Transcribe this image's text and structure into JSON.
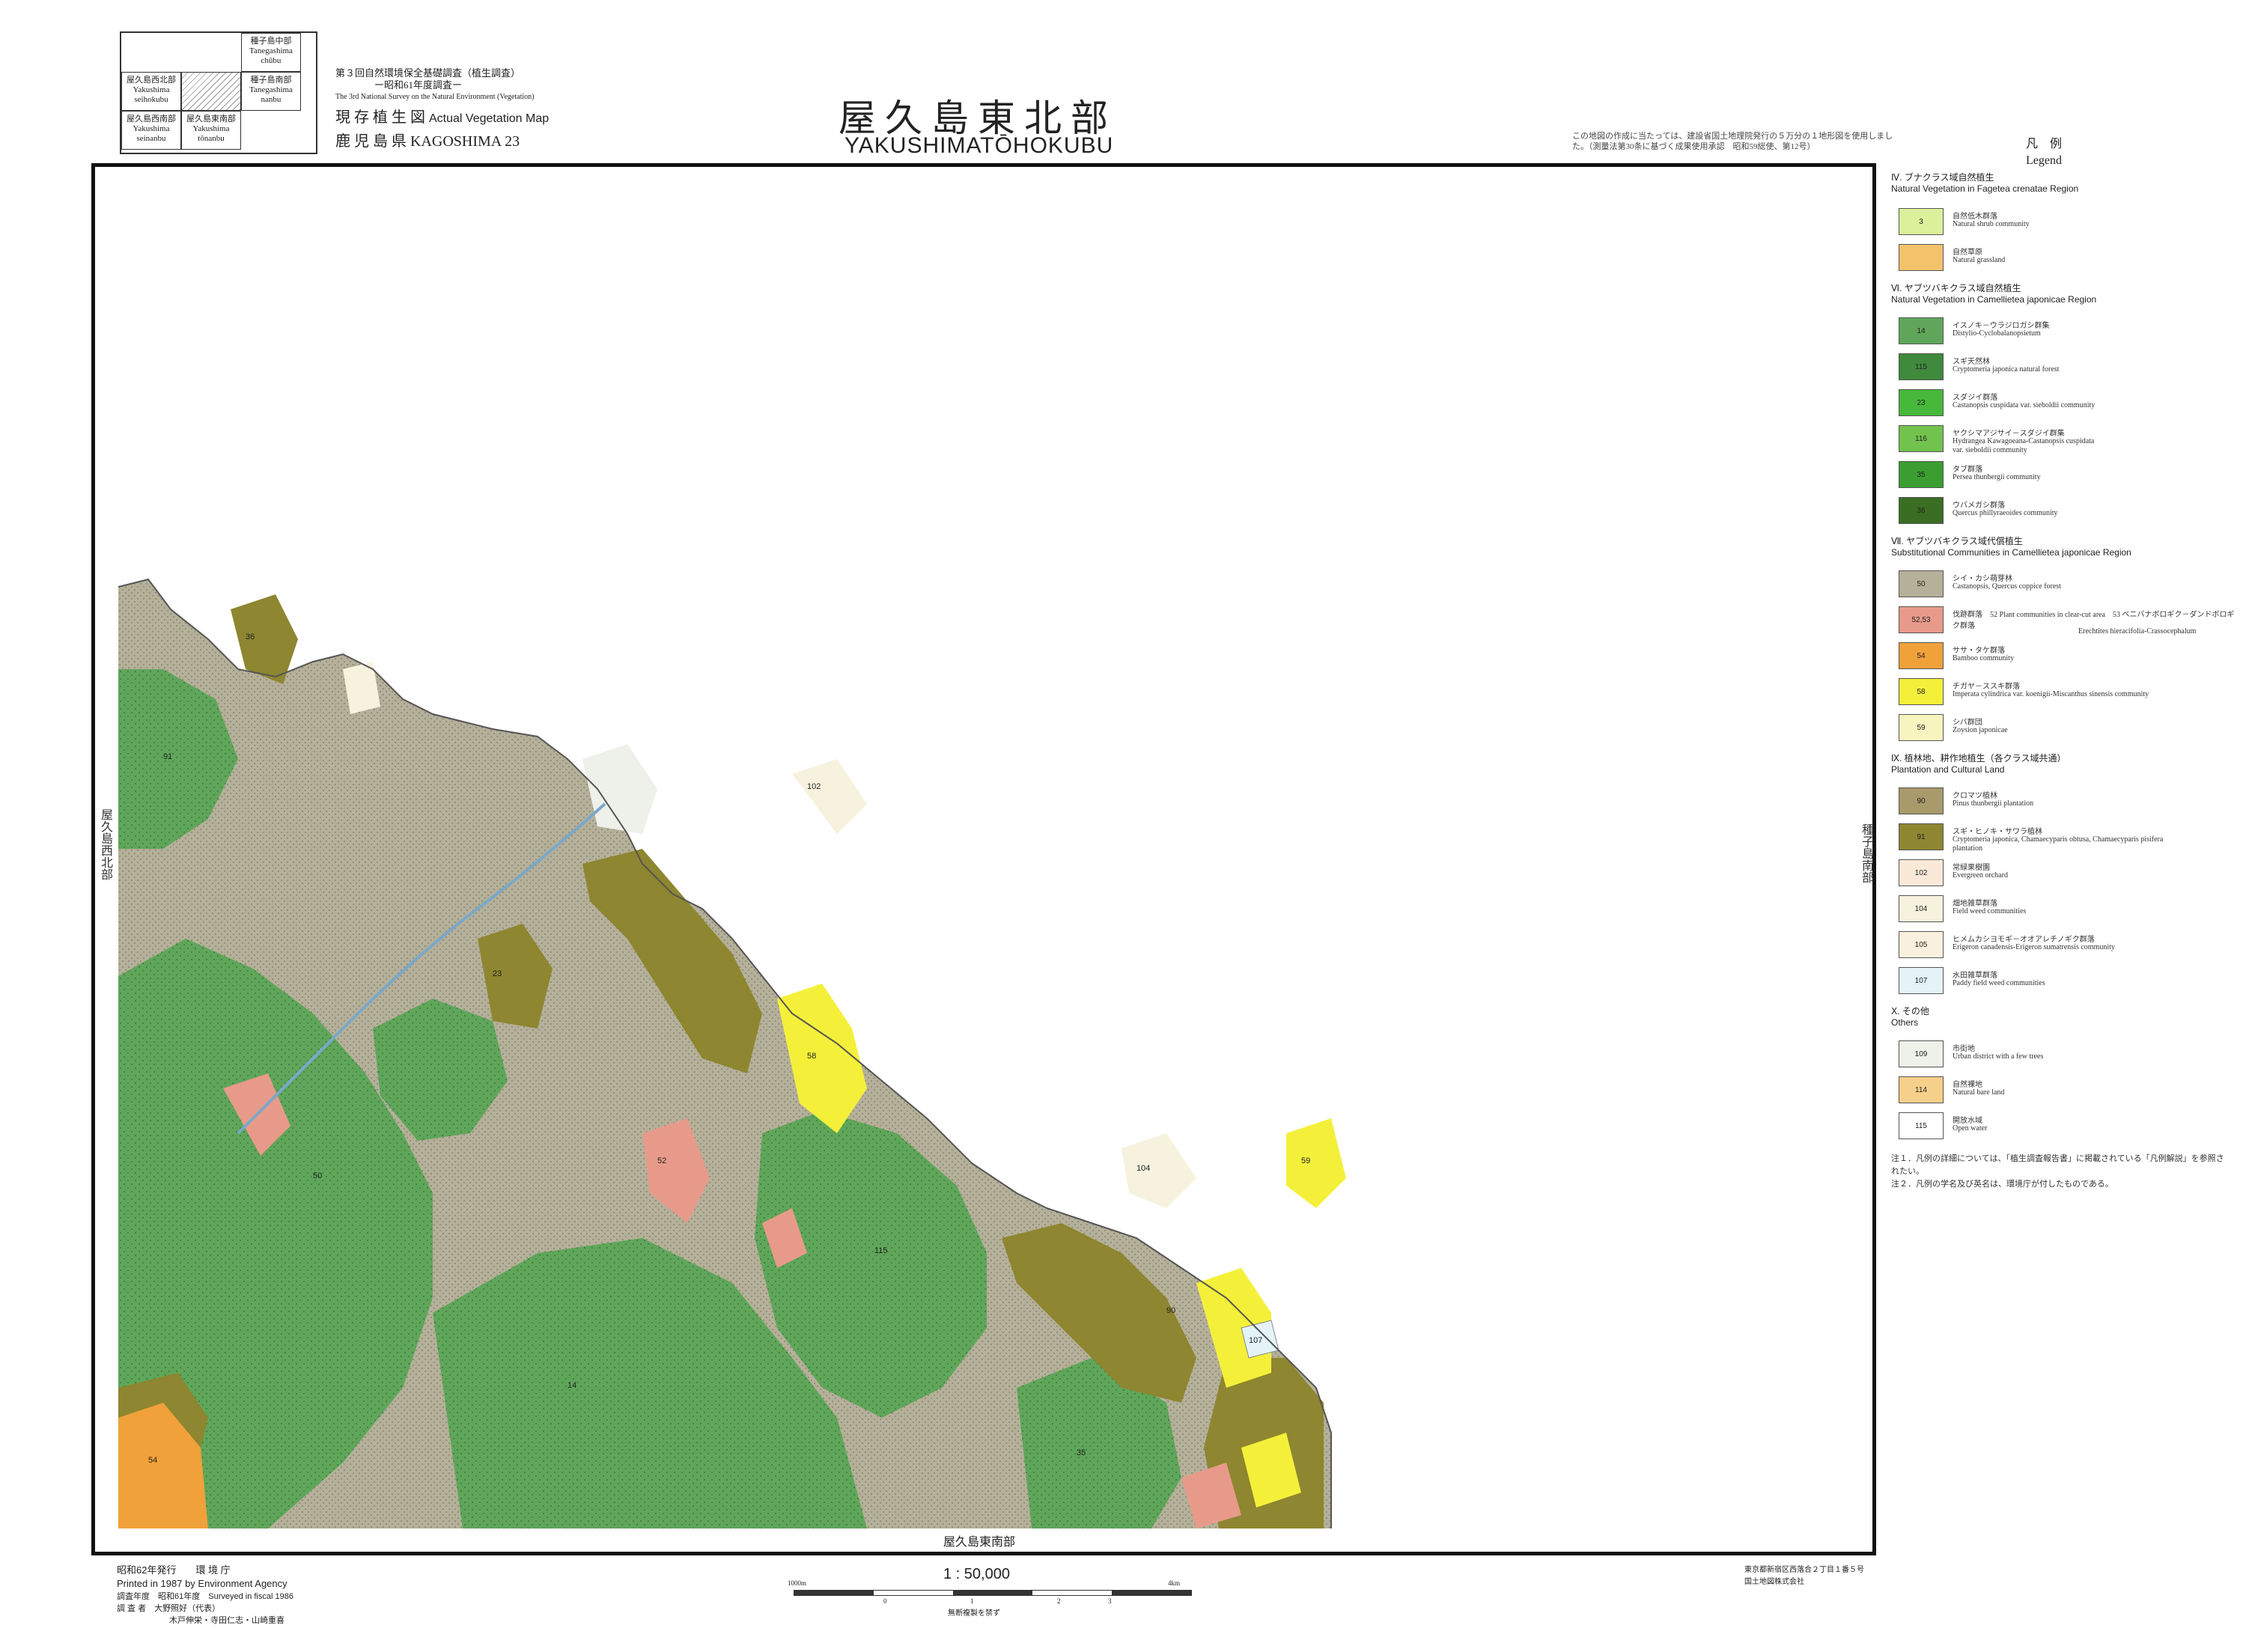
{
  "index_map": {
    "cells": [
      {
        "jp": "種子島中部",
        "en": "Tanegashima chūbu"
      },
      {
        "jp": "屋久島西北部",
        "en": "Yakushima seihokubu"
      },
      {
        "jp": "種子島南部",
        "en": "Tanegashima nanbu"
      },
      {
        "jp": "屋久島西南部",
        "en": "Yakushima seinanbu"
      },
      {
        "jp": "屋久島東南部",
        "en": "Yakushima tōnanbu"
      }
    ]
  },
  "header": {
    "survey_jp": "第３回自然環境保全基礎調査（植生調査）",
    "survey_year_jp": "ー昭和61年度調査ー",
    "survey_en": "The 3rd National Survey on the Natural Environment (Vegetation)",
    "map_type_jp": "現 存 植 生 図",
    "map_type_en": "Actual Vegetation Map",
    "prefecture": "鹿 児 島 県  KAGOSHIMA  23"
  },
  "title": {
    "jp": "屋久島東北部",
    "en": "YAKUSHIMATŌHOKUBU"
  },
  "top_note": "この地図の作成に当たっては、建設省国土地理院発行の５万分の１地形図を使用しました。（測量法第30条に基づく成果使用承認　昭和59総使、第12号）",
  "legend_title": {
    "jp": "凡　例",
    "en": "Legend"
  },
  "side_labels": {
    "west": "屋久島西北部",
    "east": "種子島南部",
    "south": "屋久島東南部"
  },
  "legend": [
    {
      "heading_jp": "Ⅳ. ブナクラス域自然植生",
      "heading_en": "Natural Vegetation in Fagetea crenatae Region",
      "items": [
        {
          "code": "3",
          "jp": "自然低木群落",
          "en": "Natural shrub community",
          "color": "#dcef9a"
        },
        {
          "code": "",
          "jp": "自然草原",
          "en": "Natural grassland",
          "color": "#f2c36b"
        }
      ]
    },
    {
      "heading_jp": "Ⅵ. ヤブツバキクラス域自然植生",
      "heading_en": "Natural Vegetation in Camellietea japonicae Region",
      "items": [
        {
          "code": "14",
          "jp": "イスノキ－ウラジロガシ群集",
          "en": "Distylio-Cyclobalanopsietum",
          "color": "#5fa65a"
        },
        {
          "code": "115",
          "jp": "スギ天然林",
          "en": "Cryptomeria japonica natural forest",
          "color": "#3f8a3c"
        },
        {
          "code": "23",
          "jp": "スダジイ群落",
          "en": "Castanopsis cuspidata var. sieboldii community",
          "color": "#46b83a"
        },
        {
          "code": "116",
          "jp": "ヤクシマアジサイ－スダジイ群集",
          "en": "Hydrangea Kawagoeana-Castanopsis cuspidata var. sieboldii community",
          "color": "#72c24e"
        },
        {
          "code": "35",
          "jp": "タブ群落",
          "en": "Persea thunbergii community",
          "color": "#3b9e30"
        },
        {
          "code": "36",
          "jp": "ウバメガシ群落",
          "en": "Quercus phillyraeoides community",
          "color": "#3a6e22"
        }
      ]
    },
    {
      "heading_jp": "Ⅶ. ヤブツバキクラス域代償植生",
      "heading_en": "Substitutional Communities in Camellietea japonicae Region",
      "items": [
        {
          "code": "50",
          "jp": "シイ・カシ萌芽林",
          "en": "Castanopsis, Quercus coppice forest",
          "color": "#b5b099"
        },
        {
          "code": "52,53",
          "jp": "伐跡群落　52 Plant communities in clear-cut area　53 ベニバナボロギク－ダンドボロギク群落",
          "en": "Erechtites hieracifolia-Crassocephalum",
          "color": "#e89a8a"
        },
        {
          "code": "54",
          "jp": "ササ・タケ群落",
          "en": "Bamboo community",
          "color": "#f0a13a"
        },
        {
          "code": "58",
          "jp": "チガヤ－ススキ群落",
          "en": "Imperata cylindrica var. koenigii-Miscanthus sinensis community",
          "color": "#f4f03a"
        },
        {
          "code": "59",
          "jp": "シバ群団",
          "en": "Zoysion japonicae",
          "color": "#f8f4c0"
        }
      ]
    },
    {
      "heading_jp": "Ⅸ. 植林地、耕作地植生（各クラス域共通）",
      "heading_en": "Plantation and Cultural Land",
      "items": [
        {
          "code": "90",
          "jp": "クロマツ植林",
          "en": "Pinus thunbergii plantation",
          "color": "#a89a6a"
        },
        {
          "code": "91",
          "jp": "スギ・ヒノキ・サワラ植林",
          "en": "Cryptomeria japonica, Chamaecyparis obtusa, Chamaecyparis pisifera plantation",
          "color": "#8e8630"
        },
        {
          "code": "102",
          "jp": "常緑果樹園",
          "en": "Evergreen orchard",
          "color": "#fbe9d8"
        },
        {
          "code": "104",
          "jp": "畑地雑草群落",
          "en": "Field weed communities",
          "color": "#f6f2de"
        },
        {
          "code": "105",
          "jp": "ヒメムカシヨモギ－オオアレチノギク群落",
          "en": "Erigeron canadensis-Erigeron sumatrensis community",
          "color": "#f9f1dd"
        },
        {
          "code": "107",
          "jp": "水田雑草群落",
          "en": "Paddy field weed communities",
          "color": "#e3f3f8"
        }
      ]
    },
    {
      "heading_jp": "Ⅹ. その他",
      "heading_en": "Others",
      "items": [
        {
          "code": "109",
          "jp": "市街地",
          "en": "Urban district with a few trees",
          "color": "#eef0ea"
        },
        {
          "code": "114",
          "jp": "自然裸地",
          "en": "Natural bare land",
          "color": "#f6d08a"
        },
        {
          "code": "115",
          "jp": "開放水域",
          "en": "Open water",
          "color": "#ffffff"
        }
      ]
    }
  ],
  "notes": [
    "注１．凡例の詳細については、「植生調査報告書」に掲載されている「凡例解説」を参照されたい。",
    "注２．凡例の学名及び英名は、環境庁が付したものである。"
  ],
  "footer": {
    "published_jp": "昭和62年発行　　環 境 庁",
    "published_en": "Printed in 1987 by Environment Agency",
    "surveyed": "調査年度　昭和61年度　Surveyed in fiscal 1986",
    "surveyors1": "調 査 者　大野照好（代表）",
    "surveyors2": "木戸伸栄・寺田仁志・山崎重喜",
    "scale": "1 : 50,000",
    "scale_ticks": [
      "1000m",
      "0",
      "1",
      "2",
      "3",
      "4km"
    ],
    "reproduction": "無断複製を禁ず",
    "printer1": "東京都新宿区西落合２丁目１番５号",
    "printer2": "国土地図株式会社"
  },
  "map_labels": [
    "91",
    "50",
    "52",
    "58",
    "104",
    "14",
    "59",
    "90",
    "102",
    "107",
    "54",
    "115",
    "36",
    "23",
    "35"
  ]
}
